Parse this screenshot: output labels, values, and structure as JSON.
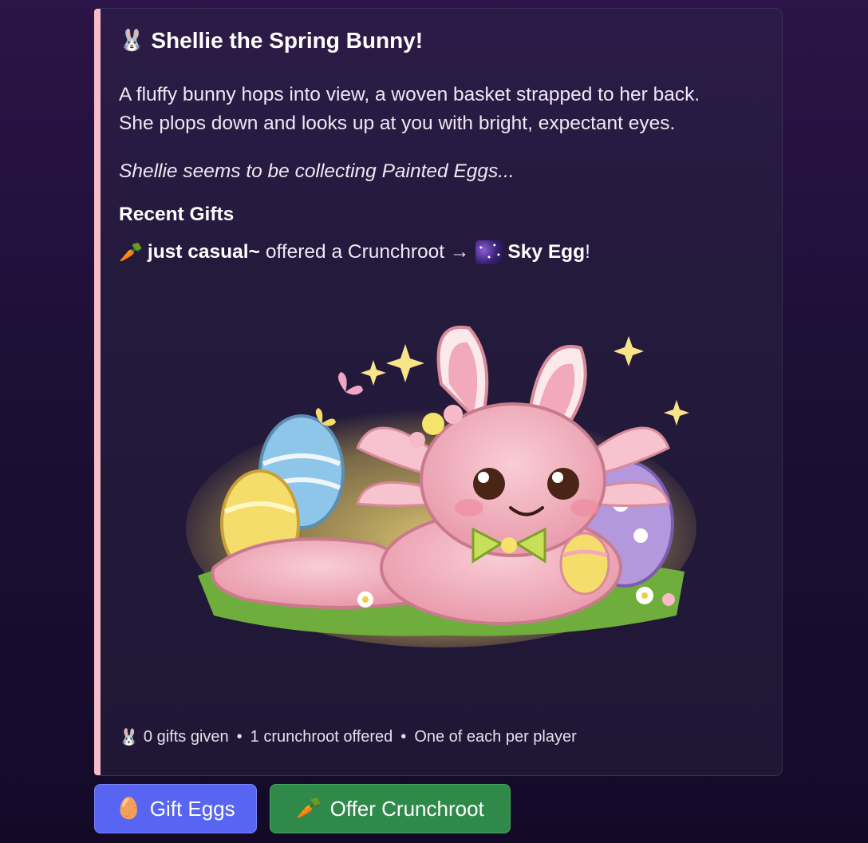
{
  "embed": {
    "accent_color": "#f6bcc9",
    "title_emoji": "🐰",
    "title": "Shellie the Spring Bunny!",
    "description_line1": "A fluffy bunny hops into view, a woven basket strapped to her back.",
    "description_line2": "She plops down and looks up at you with bright, expectant eyes.",
    "italic_note": "Shellie seems to be collecting Painted Eggs...",
    "recent_gifts_heading": "Recent Gifts",
    "recent_gift": {
      "emoji": "🥕",
      "user": "just casual~",
      "action": "offered a Crunchroot →",
      "item_icon": "sky-egg-tile",
      "item": "Sky Egg",
      "suffix": "!"
    },
    "footer": {
      "emoji": "🐰",
      "gifts_given": "0 gifts given",
      "separator": "•",
      "crunchroot_offered": "1 crunchroot offered",
      "rule": "One of each per player"
    }
  },
  "buttons": {
    "gift_eggs": {
      "emoji": "🥚",
      "label": "Gift Eggs",
      "color": "#5865f2"
    },
    "offer_crunchroot": {
      "emoji": "🥕",
      "label": "Offer Crunchroot",
      "color": "#2f8a49"
    }
  }
}
